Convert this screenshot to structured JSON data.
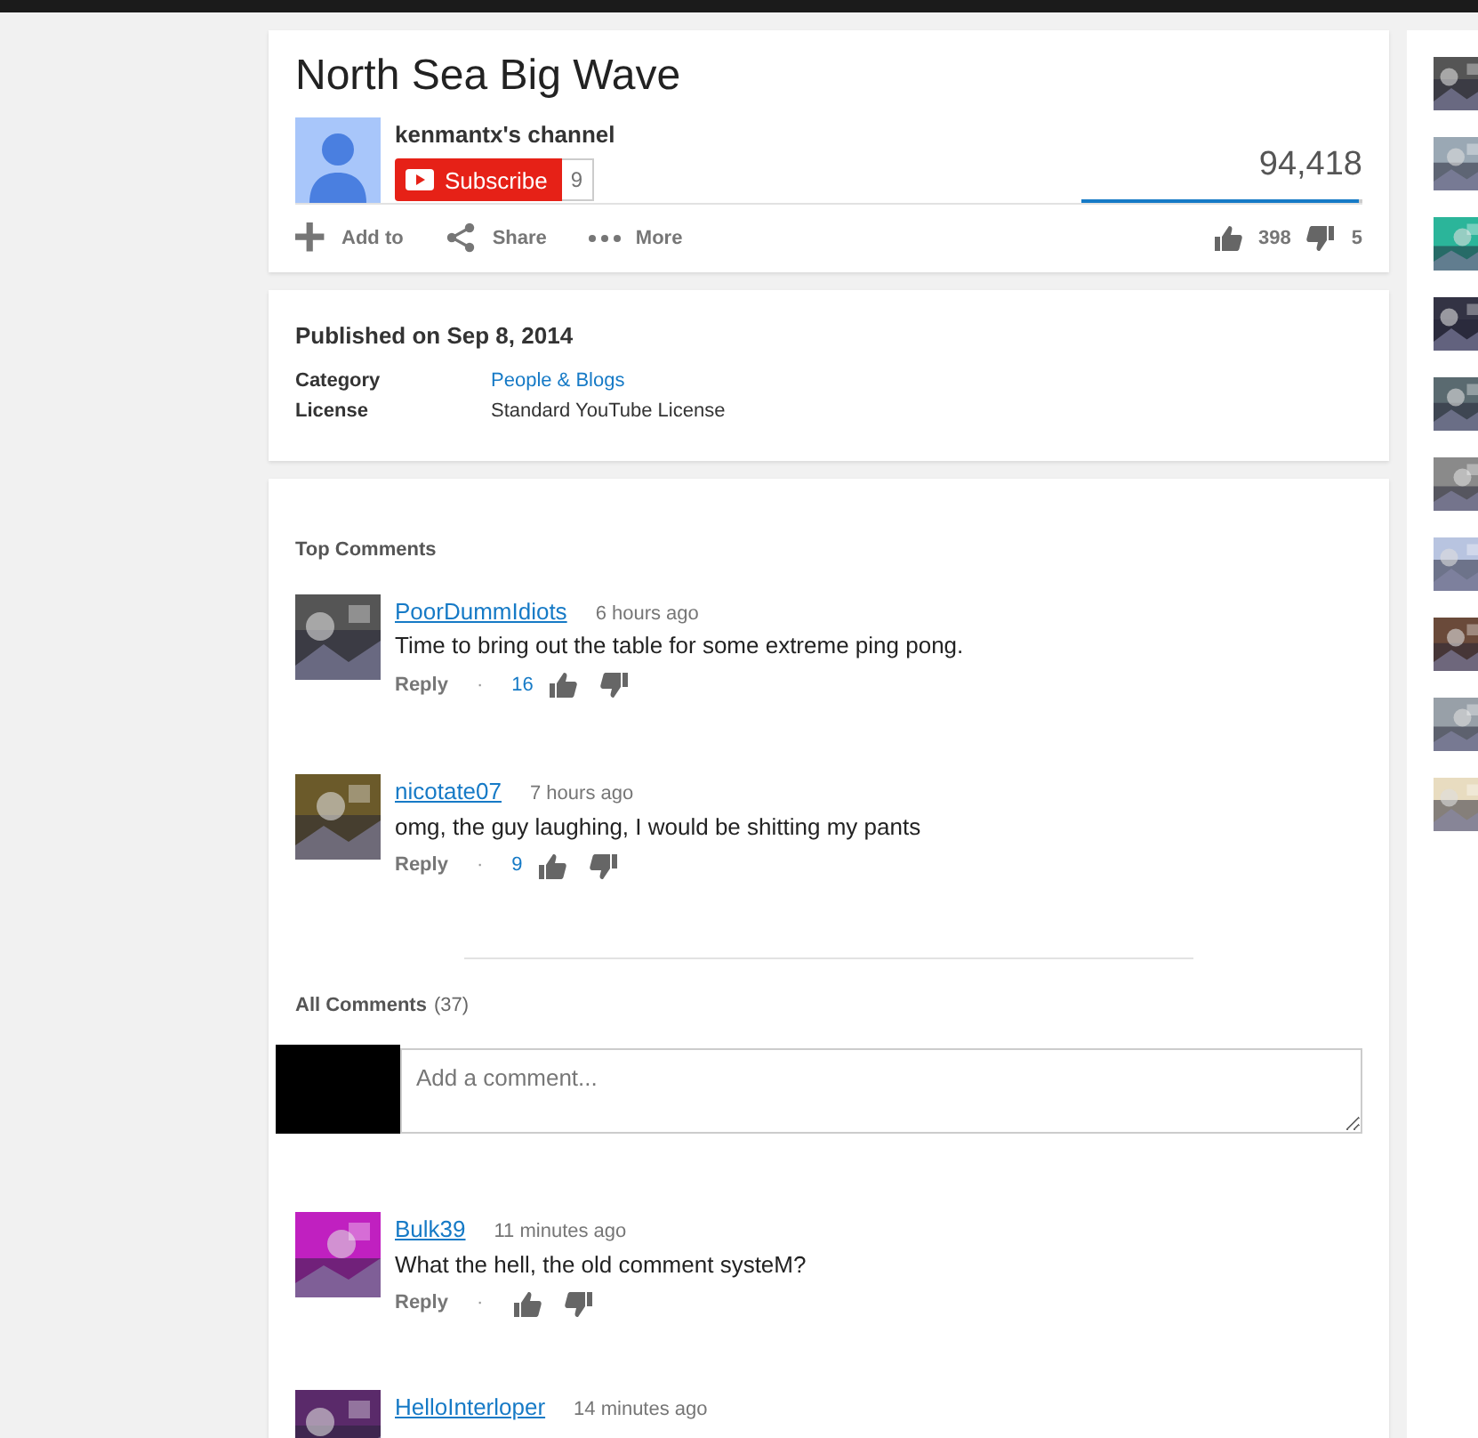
{
  "video": {
    "title": "North Sea Big Wave",
    "channel": "kenmantx's channel",
    "subscribe_label": "Subscribe",
    "subscriber_count": "9",
    "views": "94,418",
    "like_ratio": {
      "level": 0.99
    },
    "actions": [
      {
        "kind": "add",
        "label": "Add to"
      },
      {
        "kind": "share",
        "label": "Share"
      },
      {
        "kind": "more",
        "label": "More"
      }
    ],
    "likes": "398",
    "dislikes": "5"
  },
  "details": {
    "published": "Published on Sep 8, 2014",
    "rows": [
      {
        "label": "Category",
        "value": "People & Blogs"
      },
      {
        "label": "License",
        "value": "Standard YouTube License"
      }
    ]
  },
  "top_comments": {
    "heading": "Top Comments",
    "comments": [
      {
        "author": "PoorDummIdiots",
        "time": "6 hours ago",
        "text": "Time to bring out the table for some extreme ping pong.",
        "reply": "Reply",
        "separator": "·",
        "likes": "16"
      },
      {
        "author": "nicotate07",
        "time": "7 hours ago",
        "text": "omg, the guy laughing, I would be shitting my pants",
        "reply": "Reply",
        "separator": "·",
        "likes": "9"
      }
    ]
  },
  "all_comments": {
    "heading": "All Comments",
    "count": "(37)",
    "placeholder": "Add a comment...",
    "comments": [
      {
        "author": "Bulk39",
        "time": "11 minutes ago",
        "text": "What the hell, the old comment systeM?",
        "reply": "Reply",
        "separator": "·"
      },
      {
        "author": "HelloInterloper",
        "time": "14 minutes ago"
      }
    ]
  }
}
